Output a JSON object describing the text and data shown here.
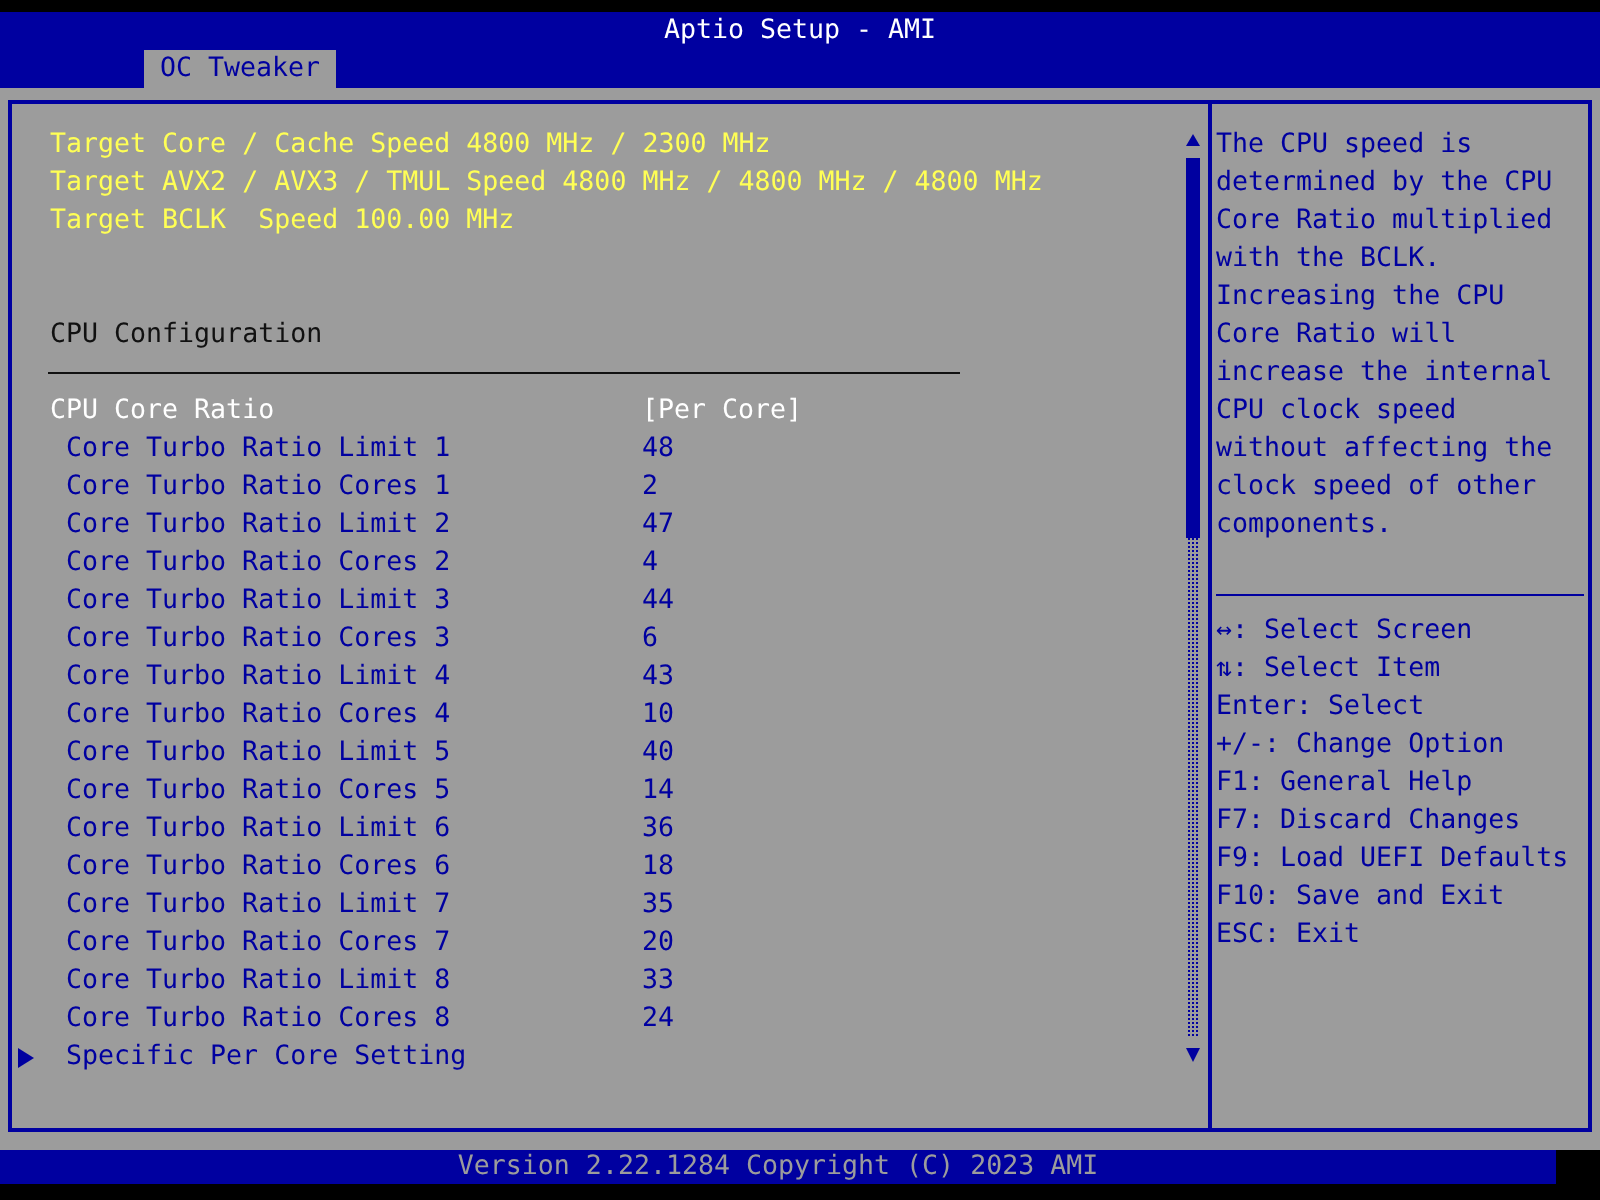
{
  "window": {
    "title": "Aptio Setup - AMI"
  },
  "tabs": [
    {
      "label": "OC Tweaker",
      "selected": true
    }
  ],
  "items": [
    {
      "kind": "info",
      "label": "Target Core / Cache Speed 4800 MHz / 2300 MHz"
    },
    {
      "kind": "info",
      "label": "Target AVX2 / AVX3 / TMUL Speed 4800 MHz / 4800 MHz / 4800 MHz"
    },
    {
      "kind": "info",
      "label": "Target BCLK  Speed 100.00 MHz"
    },
    {
      "kind": "spacer"
    },
    {
      "kind": "spacer"
    },
    {
      "kind": "heading",
      "label": "CPU Configuration"
    },
    {
      "kind": "setting",
      "label": "CPU Core Ratio",
      "value": "[Per Core]",
      "selected": true
    },
    {
      "kind": "subsetting",
      "label": "Core Turbo Ratio Limit 1",
      "value": "48",
      "selected": false
    },
    {
      "kind": "subsetting",
      "label": "Core Turbo Ratio Cores 1",
      "value": "2",
      "selected": false
    },
    {
      "kind": "subsetting",
      "label": "Core Turbo Ratio Limit 2",
      "value": "47",
      "selected": false
    },
    {
      "kind": "subsetting",
      "label": "Core Turbo Ratio Cores 2",
      "value": "4",
      "selected": false
    },
    {
      "kind": "subsetting",
      "label": "Core Turbo Ratio Limit 3",
      "value": "44",
      "selected": false
    },
    {
      "kind": "subsetting",
      "label": "Core Turbo Ratio Cores 3",
      "value": "6",
      "selected": false
    },
    {
      "kind": "subsetting",
      "label": "Core Turbo Ratio Limit 4",
      "value": "43",
      "selected": false
    },
    {
      "kind": "subsetting",
      "label": "Core Turbo Ratio Cores 4",
      "value": "10",
      "selected": false
    },
    {
      "kind": "subsetting",
      "label": "Core Turbo Ratio Limit 5",
      "value": "40",
      "selected": false
    },
    {
      "kind": "subsetting",
      "label": "Core Turbo Ratio Cores 5",
      "value": "14",
      "selected": false
    },
    {
      "kind": "subsetting",
      "label": "Core Turbo Ratio Limit 6",
      "value": "36",
      "selected": false
    },
    {
      "kind": "subsetting",
      "label": "Core Turbo Ratio Cores 6",
      "value": "18",
      "selected": false
    },
    {
      "kind": "subsetting",
      "label": "Core Turbo Ratio Limit 7",
      "value": "35",
      "selected": false
    },
    {
      "kind": "subsetting",
      "label": "Core Turbo Ratio Cores 7",
      "value": "20",
      "selected": false
    },
    {
      "kind": "subsetting",
      "label": "Core Turbo Ratio Limit 8",
      "value": "33",
      "selected": false
    },
    {
      "kind": "subsetting",
      "label": "Core Turbo Ratio Cores 8",
      "value": "24",
      "selected": false
    },
    {
      "kind": "submenu",
      "label": "Specific Per Core Setting",
      "selected": false
    }
  ],
  "help": {
    "description": "The CPU speed is determined by the CPU Core Ratio multiplied with the BCLK. Increasing the CPU Core Ratio will increase the internal CPU clock speed without affecting the clock speed of other components.",
    "keys": [
      "↔: Select Screen",
      "⇅: Select Item",
      "Enter: Select",
      "+/-: Change Option",
      "F1: General Help",
      "F7: Discard Changes",
      "F9: Load UEFI Defaults",
      "F10: Save and Exit",
      "ESC: Exit"
    ]
  },
  "status_bar": "Version 2.22.1284 Copyright (C) 2023 AMI"
}
